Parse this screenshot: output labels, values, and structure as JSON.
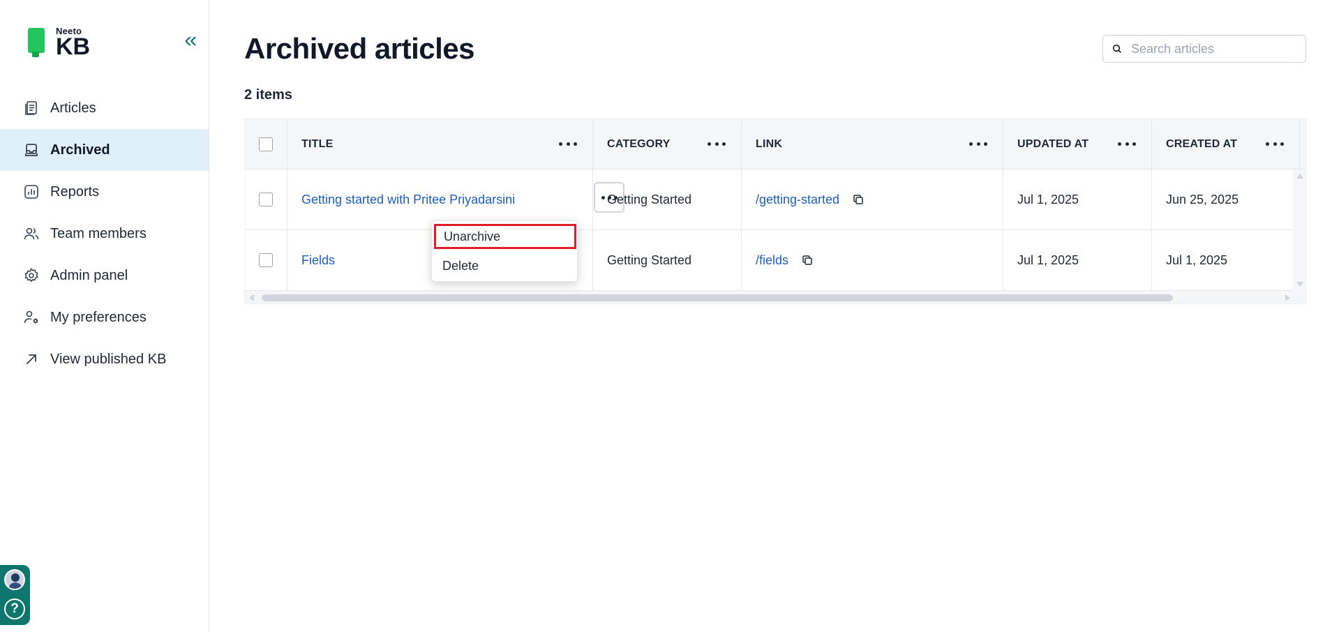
{
  "brand": {
    "small": "Neeto",
    "big": "KB"
  },
  "sidebar": {
    "items": [
      {
        "label": "Articles",
        "icon": "articles-icon",
        "active": false
      },
      {
        "label": "Archived",
        "icon": "archive-icon",
        "active": true
      },
      {
        "label": "Reports",
        "icon": "reports-icon",
        "active": false
      },
      {
        "label": "Team members",
        "icon": "team-icon",
        "active": false
      },
      {
        "label": "Admin panel",
        "icon": "gear-icon",
        "active": false
      },
      {
        "label": "My preferences",
        "icon": "user-settings-icon",
        "active": false
      },
      {
        "label": "View published KB",
        "icon": "external-arrow-icon",
        "active": false
      }
    ],
    "help_label": "?"
  },
  "main": {
    "title": "Archived articles",
    "count": "2 items",
    "search": {
      "placeholder": "Search articles",
      "value": ""
    }
  },
  "table": {
    "columns": [
      "TITLE",
      "CATEGORY",
      "LINK",
      "UPDATED AT",
      "CREATED AT"
    ],
    "rows": [
      {
        "title": "Getting started with Pritee Priyadarsini",
        "category": "Getting Started",
        "link": "/getting-started",
        "updated_at": "Jul 1, 2025",
        "created_at": "Jun 25, 2025"
      },
      {
        "title": "Fields",
        "category": "Getting Started",
        "link": "/fields",
        "updated_at": "Jul 1, 2025",
        "created_at": "Jul 1, 2025"
      }
    ]
  },
  "row_menu": {
    "items": [
      "Unarchive",
      "Delete"
    ]
  },
  "colors": {
    "accent": "#0f766e",
    "active_bg": "#e0f0fb",
    "link": "#1d5fbf",
    "highlight": "#e11d2a"
  }
}
